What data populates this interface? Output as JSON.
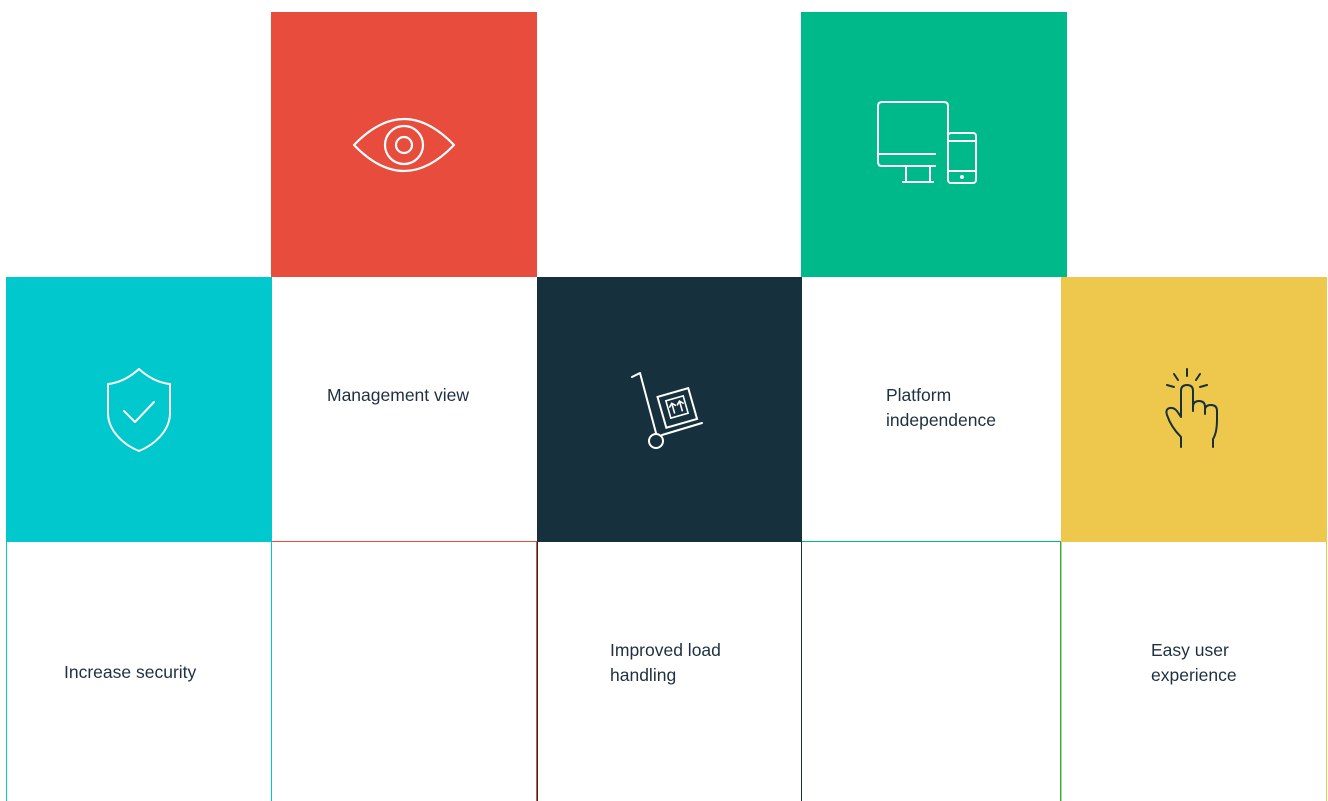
{
  "features": {
    "management_view": {
      "line1": "Management view",
      "icon": "eye-icon",
      "color": "#e74c3c"
    },
    "platform_independence": {
      "line1": "Platform",
      "line2": "independence",
      "icon": "devices-icon",
      "color": "#00b98a"
    },
    "increase_security": {
      "line1": "Increase security",
      "icon": "shield-check-icon",
      "color": "#00c8cc"
    },
    "improved_load_handling": {
      "line1": "Improved load",
      "line2": "handling",
      "icon": "hand-truck-icon",
      "color": "#17303d"
    },
    "easy_user_experience": {
      "line1": "Easy user",
      "line2": "experience",
      "icon": "pointer-hand-icon",
      "color": "#eec84d"
    }
  },
  "text_color": "#1f3040"
}
